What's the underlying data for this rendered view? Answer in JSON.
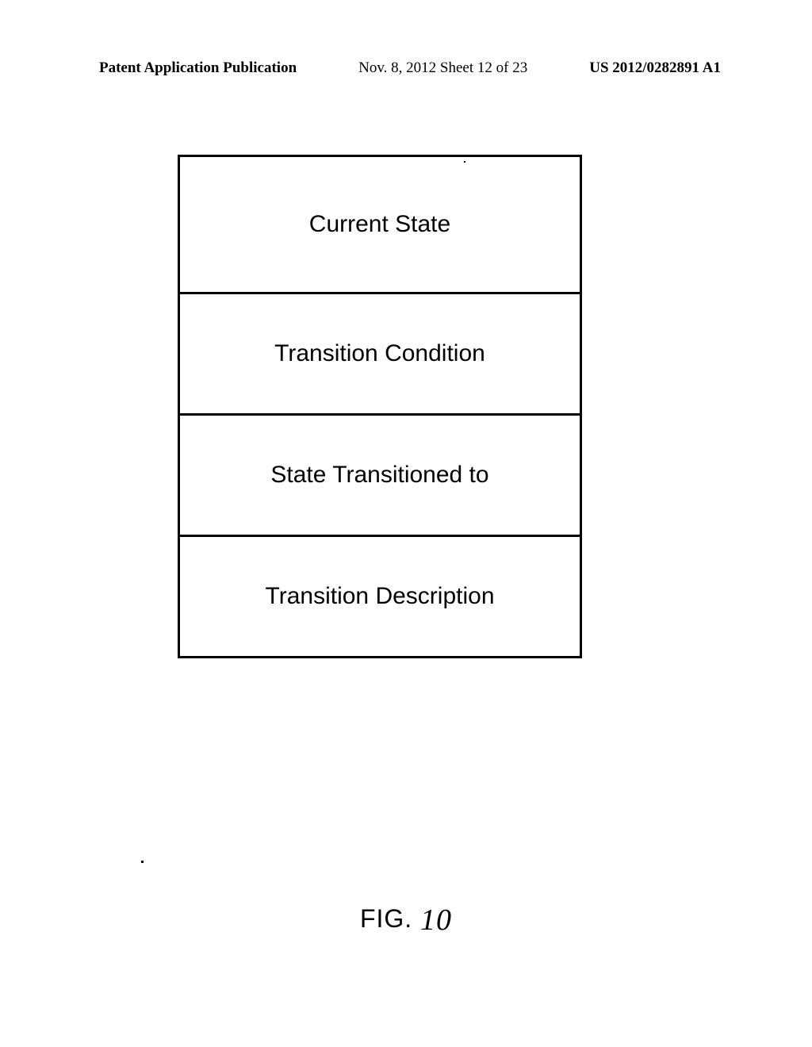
{
  "header": {
    "left": "Patent Application Publication",
    "center": "Nov. 8, 2012  Sheet 12 of 23",
    "right": "US 2012/0282891 A1"
  },
  "diagram": {
    "cells": [
      "Current State",
      "Transition Condition",
      "State Transitioned to",
      "Transition Description"
    ]
  },
  "figure": {
    "prefix": "FIG.",
    "number": "10"
  }
}
